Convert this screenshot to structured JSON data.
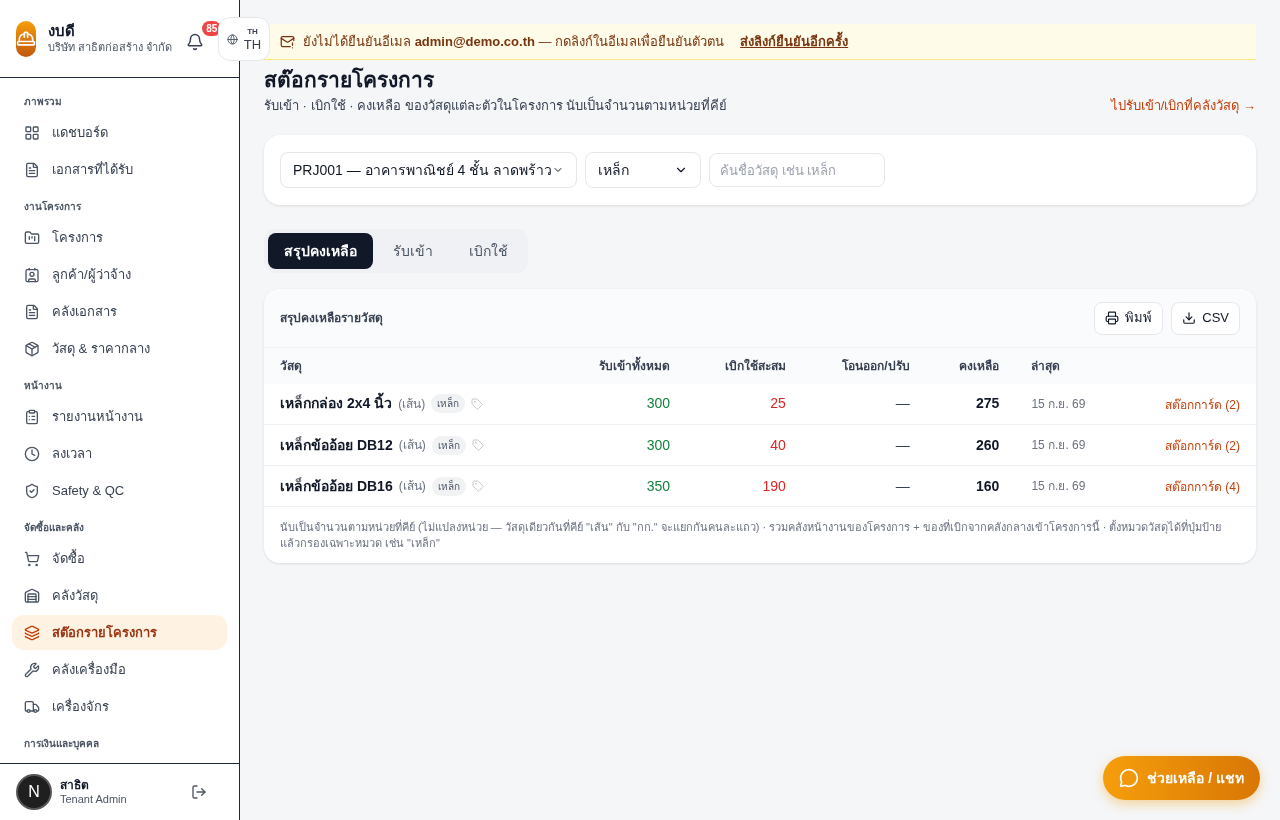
{
  "brand": {
    "name": "งบดี",
    "company": "บริษัท สาธิตก่อสร้าง จำกัด"
  },
  "notifications": {
    "count": "85"
  },
  "language": {
    "small": "TH",
    "code": "TH"
  },
  "sidebar": {
    "sections": [
      {
        "title": "ภาพรวม",
        "items": [
          {
            "label": "แดชบอร์ด",
            "selected": false
          },
          {
            "label": "เอกสารที่ได้รับ",
            "selected": false
          }
        ]
      },
      {
        "title": "งานโครงการ",
        "items": [
          {
            "label": "โครงการ",
            "selected": false
          },
          {
            "label": "ลูกค้า/ผู้ว่าจ้าง",
            "selected": false
          },
          {
            "label": "คลังเอกสาร",
            "selected": false
          },
          {
            "label": "วัสดุ & ราคากลาง",
            "selected": false
          }
        ]
      },
      {
        "title": "หน้างาน",
        "items": [
          {
            "label": "รายงานหน้างาน",
            "selected": false
          },
          {
            "label": "ลงเวลา",
            "selected": false
          },
          {
            "label": "Safety & QC",
            "selected": false
          }
        ]
      },
      {
        "title": "จัดซื้อและคลัง",
        "items": [
          {
            "label": "จัดซื้อ",
            "selected": false
          },
          {
            "label": "คลังวัสดุ",
            "selected": false
          },
          {
            "label": "สต๊อกรายโครงการ",
            "selected": true
          },
          {
            "label": "คลังเครื่องมือ",
            "selected": false
          },
          {
            "label": "เครื่องจักร",
            "selected": false
          }
        ]
      },
      {
        "title": "การเงินและบุคคล"
      }
    ]
  },
  "user": {
    "initial": "N",
    "name": "สาธิต",
    "role": "Tenant Admin"
  },
  "banner": {
    "text": "ยังไม่ได้ยืนยันอีเมล **admin@demo.co.th** — กดลิงก์ในอีเมลเพื่อยืนยันตัวตน",
    "link": "ส่งลิงก์ยืนยันอีกครั้ง"
  },
  "page": {
    "title": "สต๊อกรายโครงการ",
    "subtitle": "รับเข้า · เบิกใช้ · คงเหลือ ของวัสดุแต่ละตัวในโครงการ นับเป็นจำนวนตามหน่วยที่คีย์",
    "link": "ไปรับเข้า/เบิกที่คลังวัสดุ →"
  },
  "filters": {
    "project": "PRJ001 — อาคารพาณิชย์ 4 ชั้น ลาดพร้าว",
    "category": "เหล็ก",
    "search_placeholder": "ค้นชื่อวัสดุ เช่น เหล็ก"
  },
  "tabs": [
    {
      "label": "สรุปคงเหลือ",
      "selected": true
    },
    {
      "label": "รับเข้า",
      "selected": false
    },
    {
      "label": "เบิกใช้",
      "selected": false
    }
  ],
  "table": {
    "title": "สรุปคงเหลือรายวัสดุ",
    "buttons": [
      "พิมพ์",
      "CSV"
    ],
    "columns": [
      "วัสดุ",
      "รับเข้าทั้งหมด",
      "เบิกใช้สะสม",
      "โอนออก/ปรับ",
      "คงเหลือ",
      "ล่าสุด"
    ],
    "rows": [
      {
        "name": "เหล็กกล่อง 2x4 นิ้ว",
        "unit": "(เส้น)",
        "tag": "เหล็ก",
        "received": "300",
        "used": "25",
        "transfer": "—",
        "balance": "275",
        "latest": "15 ก.ย. 69",
        "link": "สต๊อกการ์ด (2)"
      },
      {
        "name": "เหล็กข้ออ้อย DB12",
        "unit": "(เส้น)",
        "tag": "เหล็ก",
        "received": "300",
        "used": "40",
        "transfer": "—",
        "balance": "260",
        "latest": "15 ก.ย. 69",
        "link": "สต๊อกการ์ด (2)"
      },
      {
        "name": "เหล็กข้ออ้อย DB16",
        "unit": "(เส้น)",
        "tag": "เหล็ก",
        "received": "350",
        "used": "190",
        "transfer": "—",
        "balance": "160",
        "latest": "15 ก.ย. 69",
        "link": "สต๊อกการ์ด (4)"
      }
    ],
    "footnote": "นับเป็นจำนวนตามหน่วยที่คีย์ (ไม่แปลงหน่วย — วัสดุเดียวกันที่คีย์ \"เส้น\" กับ \"กก.\" จะแยกกันคนละแถว) · รวมคลังหน้างานของโครงการ + ของที่เบิกจากคลังกลางเข้าโครงการนี้ · ตั้งหมวดวัสดุได้ที่ปุ่มป้าย แล้วกรองเฉพาะหมวด เช่น \"เหล็ก\""
  },
  "help_button": "ช่วยเหลือ / แชท"
}
